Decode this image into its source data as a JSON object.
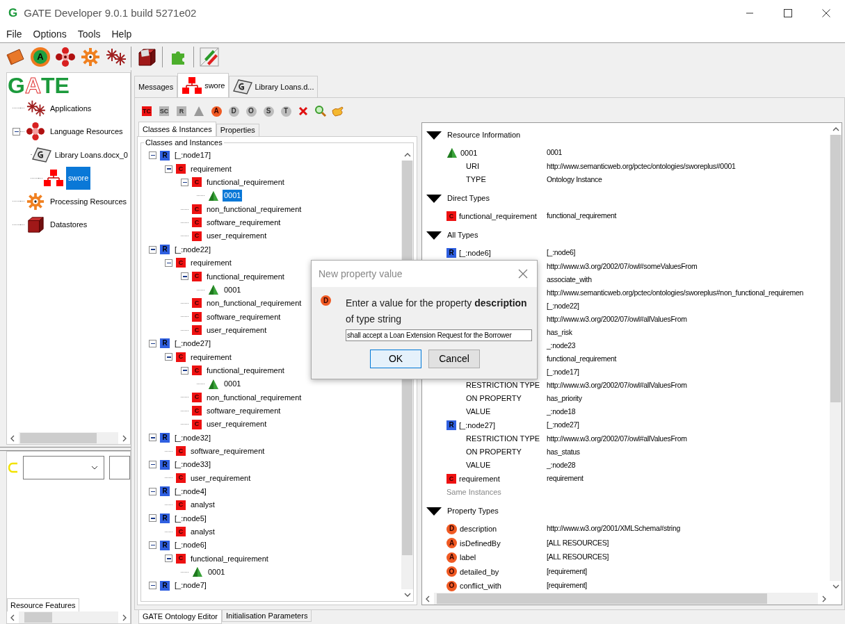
{
  "window": {
    "app_icon": "G",
    "title": "GATE Developer 9.0.1 build 5271e02"
  },
  "menu": [
    "File",
    "Options",
    "Tools",
    "Help"
  ],
  "toolbar": [
    {
      "kind": "folder"
    },
    {
      "kind": "annie",
      "badge": "A"
    },
    {
      "kind": "flower"
    },
    {
      "kind": "gear"
    },
    {
      "kind": "snowflake"
    },
    {
      "kind": "box"
    },
    {
      "kind": "puzzle"
    },
    {
      "kind": "pencils"
    }
  ],
  "resources": {
    "logo": "GATE",
    "items": [
      {
        "kind": "applications",
        "label": "Applications",
        "selected": false
      },
      {
        "kind": "language",
        "label": "Language Resources",
        "selected": false,
        "expanded": true,
        "children": [
          {
            "kind": "document",
            "label": "Library Loans.docx_0",
            "selected": false
          },
          {
            "kind": "ontology",
            "label": "swore",
            "selected": true
          }
        ]
      },
      {
        "kind": "processing",
        "label": "Processing Resources",
        "selected": false
      },
      {
        "kind": "datastore",
        "label": "Datastores",
        "selected": false
      }
    ]
  },
  "resource_features_tab": {
    "label": "Resource Features",
    "selected": true
  },
  "tabs": [
    {
      "kind": "plain",
      "label": "Messages",
      "selected": false
    },
    {
      "kind": "ontology",
      "label": "swore",
      "selected": true
    },
    {
      "kind": "document",
      "label": "Library Loans.d...",
      "selected": false
    }
  ],
  "ontology_tools": [
    {
      "kind": "square",
      "badge": "TC",
      "disabled": false
    },
    {
      "kind": "square",
      "badge": "SC",
      "disabled": true
    },
    {
      "kind": "square",
      "badge": "R",
      "disabled": true
    },
    {
      "kind": "triangle",
      "disabled": true
    },
    {
      "kind": "circle",
      "badge": "A",
      "disabled": false
    },
    {
      "kind": "circle",
      "badge": "D",
      "disabled": true
    },
    {
      "kind": "circle",
      "badge": "O",
      "disabled": true
    },
    {
      "kind": "circle",
      "badge": "S",
      "disabled": true
    },
    {
      "kind": "circle",
      "badge": "T",
      "disabled": true
    },
    {
      "kind": "delete",
      "disabled": false
    },
    {
      "kind": "search",
      "disabled": false
    },
    {
      "kind": "hand",
      "disabled": false
    }
  ],
  "browser_tabs": [
    {
      "label": "Classes & Instances",
      "selected": true
    },
    {
      "label": "Properties",
      "selected": false
    }
  ],
  "group_title": "Classes and Instances",
  "ontology_tree": [
    {
      "kind": "restriction",
      "badge": "R",
      "label": "[_:node17]",
      "selected": false,
      "expanded": true,
      "children": [
        {
          "kind": "class",
          "badge": "C",
          "label": "requirement",
          "selected": false,
          "expanded": true,
          "children": [
            {
              "kind": "class",
              "badge": "C",
              "label": "functional_requirement",
              "selected": false,
              "expanded": true,
              "children": [
                {
                  "kind": "instance",
                  "label": "0001",
                  "selected": true
                }
              ]
            },
            {
              "kind": "class",
              "badge": "C",
              "label": "non_functional_requirement",
              "selected": false
            },
            {
              "kind": "class",
              "badge": "C",
              "label": "software_requirement",
              "selected": false
            },
            {
              "kind": "class",
              "badge": "C",
              "label": "user_requirement",
              "selected": false
            }
          ]
        }
      ]
    },
    {
      "kind": "restriction",
      "badge": "R",
      "label": "[_:node22]",
      "selected": false,
      "expanded": true,
      "children": [
        {
          "kind": "class",
          "badge": "C",
          "label": "requirement",
          "selected": false,
          "expanded": true,
          "children": [
            {
              "kind": "class",
              "badge": "C",
              "label": "functional_requirement",
              "selected": false,
              "expanded": true,
              "children": [
                {
                  "kind": "instance",
                  "label": "0001",
                  "selected": false
                }
              ]
            },
            {
              "kind": "class",
              "badge": "C",
              "label": "non_functional_requirement",
              "selected": false
            },
            {
              "kind": "class",
              "badge": "C",
              "label": "software_requirement",
              "selected": false
            },
            {
              "kind": "class",
              "badge": "C",
              "label": "user_requirement",
              "selected": false
            }
          ]
        }
      ]
    },
    {
      "kind": "restriction",
      "badge": "R",
      "label": "[_:node27]",
      "selected": false,
      "expanded": true,
      "children": [
        {
          "kind": "class",
          "badge": "C",
          "label": "requirement",
          "selected": false,
          "expanded": true,
          "children": [
            {
              "kind": "class",
              "badge": "C",
              "label": "functional_requirement",
              "selected": false,
              "expanded": true,
              "children": [
                {
                  "kind": "instance",
                  "label": "0001",
                  "selected": false
                }
              ]
            },
            {
              "kind": "class",
              "badge": "C",
              "label": "non_functional_requirement",
              "selected": false
            },
            {
              "kind": "class",
              "badge": "C",
              "label": "software_requirement",
              "selected": false
            },
            {
              "kind": "class",
              "badge": "C",
              "label": "user_requirement",
              "selected": false
            }
          ]
        }
      ]
    },
    {
      "kind": "restriction",
      "badge": "R",
      "label": "[_:node32]",
      "selected": false,
      "expanded": true,
      "children": [
        {
          "kind": "class",
          "badge": "C",
          "label": "software_requirement",
          "selected": false
        }
      ]
    },
    {
      "kind": "restriction",
      "badge": "R",
      "label": "[_:node33]",
      "selected": false,
      "expanded": true,
      "children": [
        {
          "kind": "class",
          "badge": "C",
          "label": "user_requirement",
          "selected": false
        }
      ]
    },
    {
      "kind": "restriction",
      "badge": "R",
      "label": "[_:node4]",
      "selected": false,
      "expanded": true,
      "children": [
        {
          "kind": "class",
          "badge": "C",
          "label": "analyst",
          "selected": false
        }
      ]
    },
    {
      "kind": "restriction",
      "badge": "R",
      "label": "[_:node5]",
      "selected": false,
      "expanded": true,
      "children": [
        {
          "kind": "class",
          "badge": "C",
          "label": "analyst",
          "selected": false
        }
      ]
    },
    {
      "kind": "restriction",
      "badge": "R",
      "label": "[_:node6]",
      "selected": false,
      "expanded": true,
      "children": [
        {
          "kind": "class",
          "badge": "C",
          "label": "functional_requirement",
          "selected": false,
          "expanded": true,
          "children": [
            {
              "kind": "instance",
              "label": "0001",
              "selected": false
            }
          ]
        }
      ]
    },
    {
      "kind": "restriction",
      "badge": "R",
      "label": "[_:node7]",
      "selected": false,
      "expanded": true
    }
  ],
  "details": [
    {
      "title": "Resource Information",
      "expanded": true,
      "rows": [
        {
          "kind": "instance",
          "label": "0001",
          "value": "0001"
        },
        {
          "kind": "attribute",
          "label": "URI",
          "value": "http://www.semanticweb.org/pctec/ontologies/sworeplus#0001"
        },
        {
          "kind": "attribute",
          "label": "TYPE",
          "value": "Ontology Instance"
        }
      ]
    },
    {
      "title": "Direct Types",
      "expanded": true,
      "rows": [
        {
          "kind": "class",
          "badge": "C",
          "label": "functional_requirement",
          "value": "functional_requirement"
        }
      ]
    },
    {
      "title": "All Types",
      "expanded": true,
      "rows": [
        {
          "kind": "restriction",
          "badge": "R",
          "label": "[_:node6]",
          "value": "[_:node6]"
        },
        {
          "kind": "attribute",
          "value": "http://www.w3.org/2002/07/owl#someValuesFrom"
        },
        {
          "kind": "attribute",
          "value": "associate_with"
        },
        {
          "kind": "attribute",
          "value": "http://www.semanticweb.org/pctec/ontologies/sworeplus#non_functional_requiremen"
        },
        {
          "kind": "attribute",
          "value": "[_:node22]"
        },
        {
          "kind": "attribute",
          "value": "http://www.w3.org/2002/07/owl#allValuesFrom"
        },
        {
          "kind": "attribute",
          "value": "has_risk"
        },
        {
          "kind": "attribute",
          "value": "_:node23"
        },
        {
          "kind": "attribute",
          "value": "functional_requirement"
        },
        {
          "kind": "attribute",
          "value": "[_:node17]"
        },
        {
          "kind": "attribute",
          "label": "RESTRICTION TYPE",
          "value": "http://www.w3.org/2002/07/owl#allValuesFrom"
        },
        {
          "kind": "attribute",
          "label": "ON PROPERTY",
          "value": "has_priority"
        },
        {
          "kind": "attribute",
          "label": "VALUE",
          "value": "_:node18"
        },
        {
          "kind": "restriction",
          "badge": "R",
          "label": "[_:node27]",
          "value": "[_:node27]"
        },
        {
          "kind": "attribute",
          "label": "RESTRICTION TYPE",
          "value": "http://www.w3.org/2002/07/owl#allValuesFrom"
        },
        {
          "kind": "attribute",
          "label": "ON PROPERTY",
          "value": "has_status"
        },
        {
          "kind": "attribute",
          "label": "VALUE",
          "value": "_:node28"
        },
        {
          "kind": "class",
          "badge": "C",
          "label": "requirement",
          "value": "requirement"
        },
        {
          "kind": "note",
          "label": "Same Instances"
        }
      ]
    },
    {
      "title": "Property Types",
      "expanded": true,
      "rows": [
        {
          "kind": "property",
          "badge": "D",
          "label": "description",
          "value": "http://www.w3.org/2001/XMLSchema#string"
        },
        {
          "kind": "property",
          "badge": "A",
          "label": "isDefinedBy",
          "value": "[ALL RESOURCES]"
        },
        {
          "kind": "property",
          "badge": "A",
          "label": "label",
          "value": "[ALL RESOURCES]"
        },
        {
          "kind": "property",
          "badge": "O",
          "label": "detailed_by",
          "value": "[requirement]"
        },
        {
          "kind": "property",
          "badge": "O",
          "label": "conflict_with",
          "value": "[requirement]"
        }
      ]
    }
  ],
  "bottom_tabs": [
    {
      "label": "GATE Ontology Editor",
      "selected": true
    },
    {
      "label": "Initialisation Parameters",
      "selected": false
    }
  ],
  "dialog": {
    "title": "New property value",
    "badge": "D",
    "message": [
      "Enter a value for the property **description**",
      "of type string"
    ],
    "value": "shall accept a Loan Extension Request for the Borrower",
    "buttons": [
      {
        "label": "OK",
        "default": true
      },
      {
        "label": "Cancel",
        "default": false
      }
    ]
  }
}
